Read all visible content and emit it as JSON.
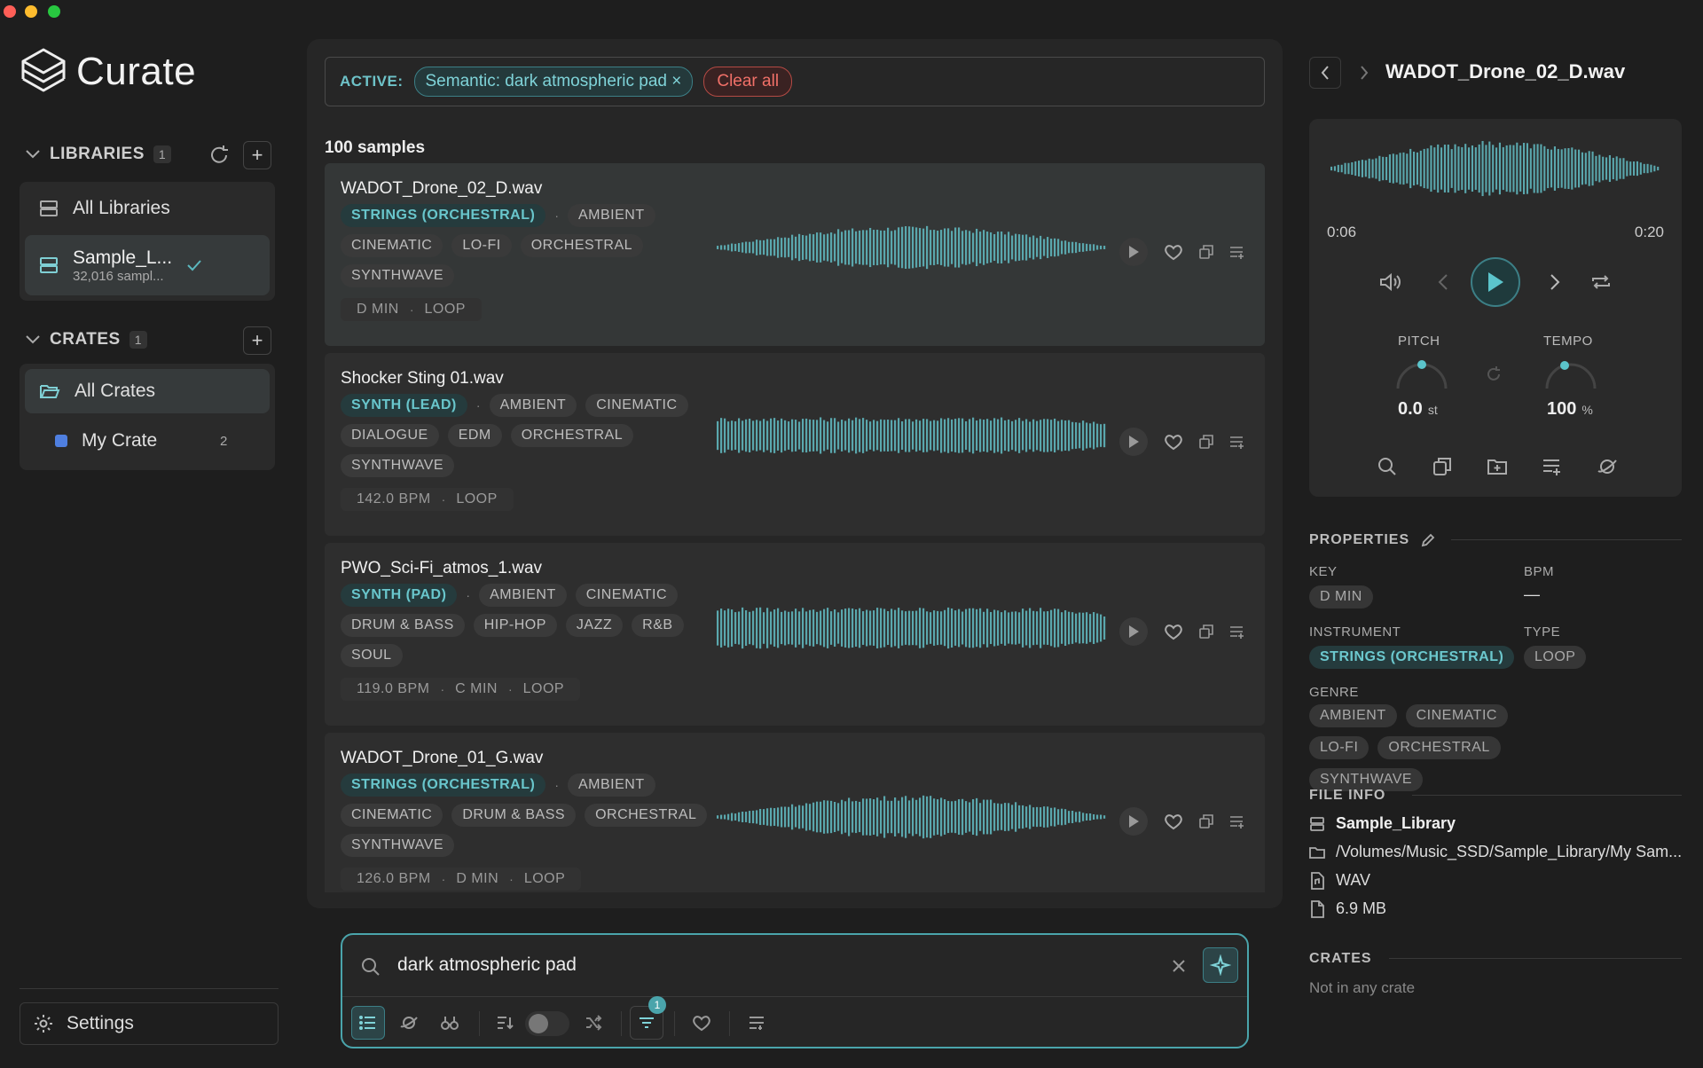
{
  "app": {
    "name": "Curate"
  },
  "sidebar": {
    "libraries": {
      "label": "LIBRARIES",
      "count": "1",
      "items": [
        {
          "label": "All Libraries"
        },
        {
          "label": "Sample_L...",
          "sub": "32,016 sampl..."
        }
      ]
    },
    "crates": {
      "label": "CRATES",
      "count": "1",
      "items": [
        {
          "label": "All Crates"
        },
        {
          "label": "My Crate",
          "count": "2",
          "color": "#4f7fe0"
        }
      ]
    },
    "settings_label": "Settings"
  },
  "filters": {
    "active_label": "ACTIVE:",
    "chip": "Semantic: dark atmospheric pad ×",
    "clear": "Clear all"
  },
  "results": {
    "count": "100 samples"
  },
  "samples": [
    {
      "name": "WADOT_Drone_02_D.wav",
      "instrument": "STRINGS (ORCHESTRAL)",
      "genres": [
        "AMBIENT",
        "CINEMATIC",
        "LO-FI",
        "ORCHESTRAL",
        "SYNTHWAVE"
      ],
      "meta": [
        "D MIN",
        "LOOP"
      ]
    },
    {
      "name": "Shocker Sting 01.wav",
      "instrument": "SYNTH (LEAD)",
      "genres": [
        "AMBIENT",
        "CINEMATIC",
        "DIALOGUE",
        "EDM",
        "ORCHESTRAL",
        "SYNTHWAVE"
      ],
      "meta": [
        "142.0 BPM",
        "LOOP"
      ]
    },
    {
      "name": "PWO_Sci-Fi_atmos_1.wav",
      "instrument": "SYNTH (PAD)",
      "genres": [
        "AMBIENT",
        "CINEMATIC",
        "DRUM & BASS",
        "HIP-HOP",
        "JAZZ",
        "R&B",
        "SOUL"
      ],
      "meta": [
        "119.0 BPM",
        "C MIN",
        "LOOP"
      ]
    },
    {
      "name": "WADOT_Drone_01_G.wav",
      "instrument": "STRINGS (ORCHESTRAL)",
      "genres": [
        "AMBIENT",
        "CINEMATIC",
        "DRUM & BASS",
        "ORCHESTRAL",
        "SYNTHWAVE"
      ],
      "meta": [
        "126.0 BPM",
        "D MIN",
        "LOOP"
      ]
    }
  ],
  "search": {
    "query": "dark atmospheric pad",
    "filter_badge": "1"
  },
  "detail": {
    "title": "WADOT_Drone_02_D.wav",
    "time_current": "0:06",
    "time_total": "0:20",
    "pitch": {
      "label": "PITCH",
      "value": "0.0",
      "unit": "st"
    },
    "tempo": {
      "label": "TEMPO",
      "value": "100",
      "unit": "%"
    },
    "properties": {
      "heading": "PROPERTIES",
      "key_label": "KEY",
      "key": "D MIN",
      "bpm_label": "BPM",
      "bpm": "—",
      "instrument_label": "INSTRUMENT",
      "instrument": "STRINGS (ORCHESTRAL)",
      "type_label": "TYPE",
      "type": "LOOP",
      "genre_label": "GENRE",
      "genres": [
        "AMBIENT",
        "CINEMATIC",
        "LO-FI",
        "ORCHESTRAL",
        "SYNTHWAVE"
      ]
    },
    "file_info": {
      "heading": "FILE INFO",
      "library": "Sample_Library",
      "path": "/Volumes/Music_SSD/Sample_Library/My Sam...",
      "format": "WAV",
      "size": "6.9 MB"
    },
    "crates": {
      "heading": "CRATES",
      "value": "Not in any crate"
    }
  },
  "colors": {
    "accent": "#5bb8bf",
    "danger": "#f07068"
  }
}
